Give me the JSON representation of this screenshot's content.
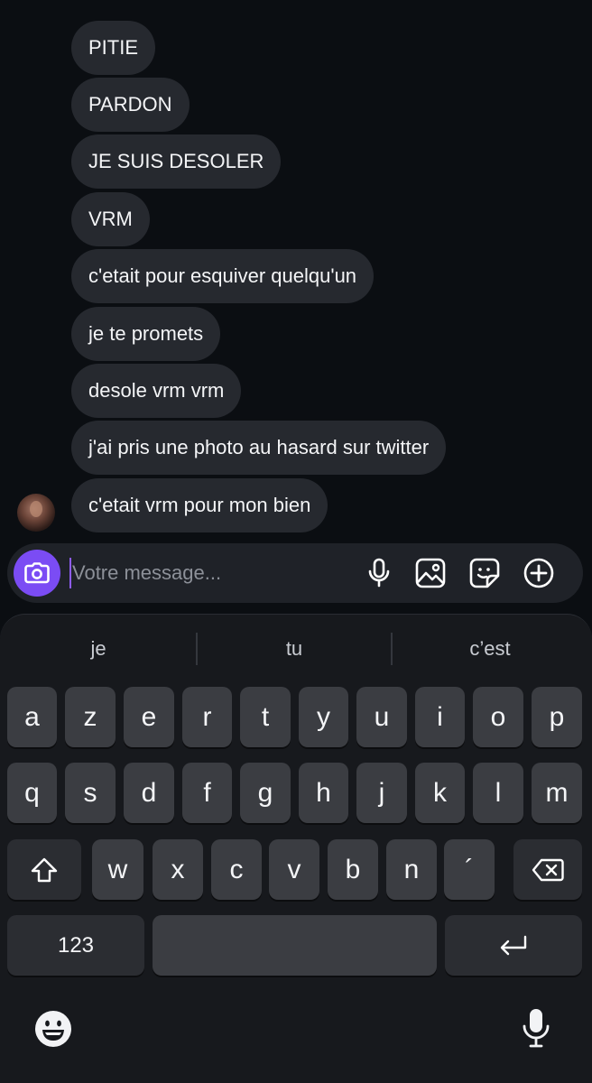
{
  "chat": {
    "messages": [
      "PITIE",
      "PARDON",
      "JE SUIS DESOLER",
      "VRM",
      "c'etait pour esquiver quelqu'un",
      "je te promets",
      "desole vrm vrm",
      "j'ai pris une photo au hasard sur twitter",
      "c'etait vrm pour mon bien"
    ],
    "avatar_icon": "contact-avatar"
  },
  "composer": {
    "placeholder": "Votre message...",
    "accent_color": "#7b4cf4",
    "icons": [
      "camera-icon",
      "microphone-icon",
      "image-icon",
      "sticker-icon",
      "plus-circle-icon"
    ]
  },
  "keyboard": {
    "suggestions": [
      "je",
      "tu",
      "c’est"
    ],
    "row1": [
      "a",
      "z",
      "e",
      "r",
      "t",
      "y",
      "u",
      "i",
      "o",
      "p"
    ],
    "row2": [
      "q",
      "s",
      "d",
      "f",
      "g",
      "h",
      "j",
      "k",
      "l",
      "m"
    ],
    "row3": [
      "w",
      "x",
      "c",
      "v",
      "b",
      "n",
      "´"
    ],
    "numbers_label": "123",
    "icons": [
      "shift-icon",
      "backspace-icon",
      "return-icon",
      "emoji-icon",
      "dictation-icon"
    ]
  }
}
